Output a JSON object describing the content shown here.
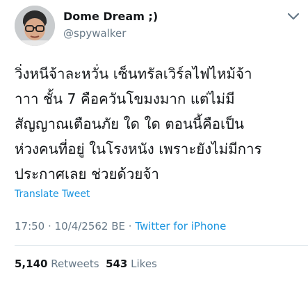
{
  "author": {
    "display_name": "Dome Dream ;)",
    "handle": "@spywalker"
  },
  "tweet": {
    "lines": [
      "วิ่งหนีจ้าละหวั่น เซ็นทรัลเวิร์ลไฟไหม้จ้า",
      "าาา ชั้น 7 คือควันโขมงมาก แต่ไม่มี",
      "สัญญาณเตือนภัย ใด ใด ตอนนี้คือเป็น",
      "ห่วงคนที่อยู่ ในโรงหนัง เพราะยังไม่มีการ",
      "ประกาศเลย ช่วยด้วยจ้า"
    ],
    "translate_label": "Translate Tweet"
  },
  "meta": {
    "time": "17:50",
    "separator": " · ",
    "date": "10/4/2562 BE",
    "separator2": " · ",
    "source": "Twitter for iPhone"
  },
  "stats": {
    "retweets_count": "5,140",
    "retweets_label": "Retweets",
    "likes_count": "543",
    "likes_label": "Likes"
  },
  "colors": {
    "link": "#1b95e0",
    "secondary_text": "#657786",
    "primary_text": "#14171a"
  },
  "icons": {
    "menu": "chevron-down-icon",
    "avatar": "avatar"
  }
}
